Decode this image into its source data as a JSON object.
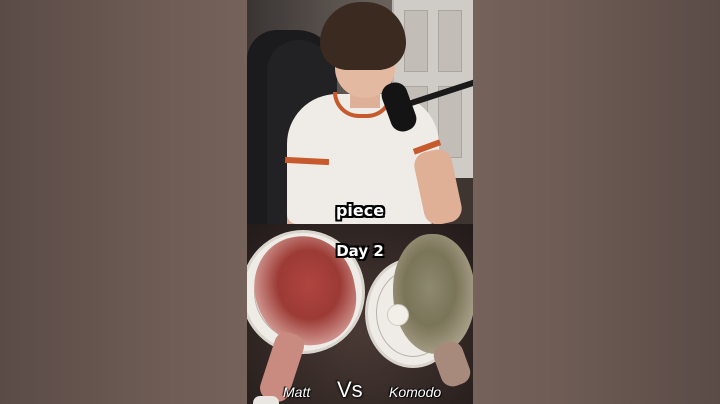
{
  "top_caption": "piece",
  "day_label": "Day 2",
  "left_name": "Matt",
  "vs_text": "Vs",
  "right_name": "Komodo"
}
